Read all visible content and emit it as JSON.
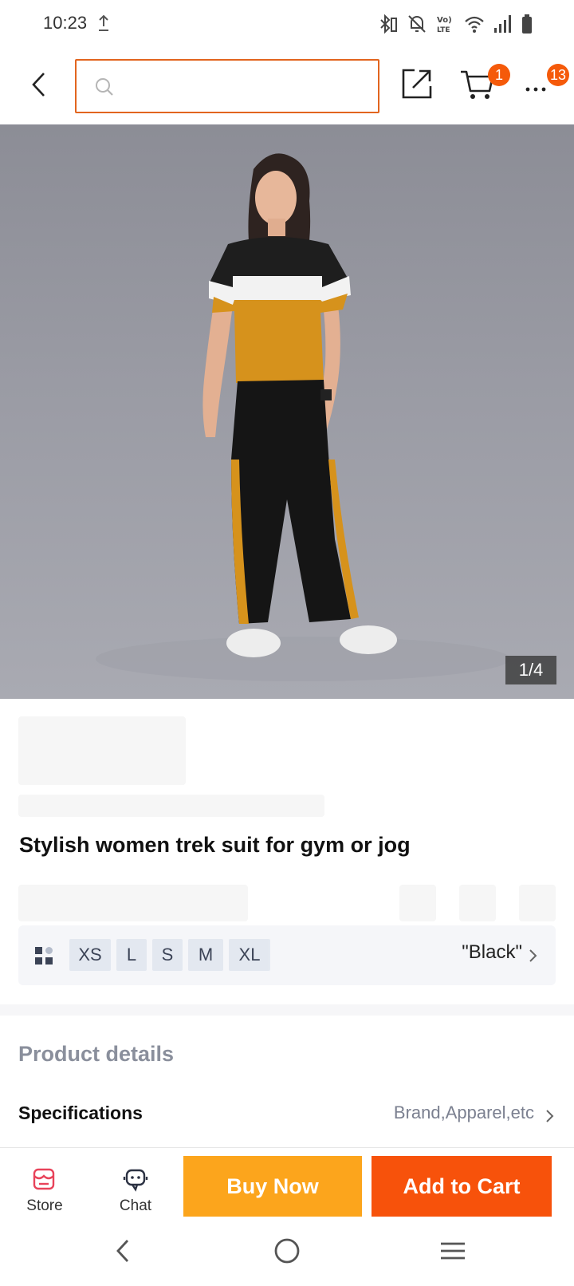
{
  "status_bar": {
    "time": "10:23",
    "icons": [
      "upload-icon",
      "bluetooth-battery-icon",
      "mute-icon",
      "volte-icon",
      "wifi-icon",
      "signal-icon",
      "battery-icon"
    ]
  },
  "header": {
    "search": {
      "value": "",
      "placeholder": ""
    },
    "cart_badge": "1",
    "more_badge": "13",
    "accent_color": "#e2651f"
  },
  "gallery": {
    "counter": "1/4"
  },
  "product": {
    "title": "Stylish women trek suit for gym or jog"
  },
  "variants": {
    "sizes": [
      "XS",
      "L",
      "S",
      "M",
      "XL"
    ],
    "selected_color": "\"Black\""
  },
  "details": {
    "section_title": "Product details",
    "specifications_label": "Specifications",
    "specifications_value": "Brand,Apparel,etc"
  },
  "bottom_bar": {
    "store_label": "Store",
    "chat_label": "Chat",
    "buy_now_label": "Buy Now",
    "add_to_cart_label": "Add to Cart",
    "buy_now_color": "#fca51c",
    "add_to_cart_color": "#f7520b"
  },
  "nav_bar": {
    "icons": [
      "back-icon",
      "home-icon",
      "recents-icon"
    ]
  }
}
